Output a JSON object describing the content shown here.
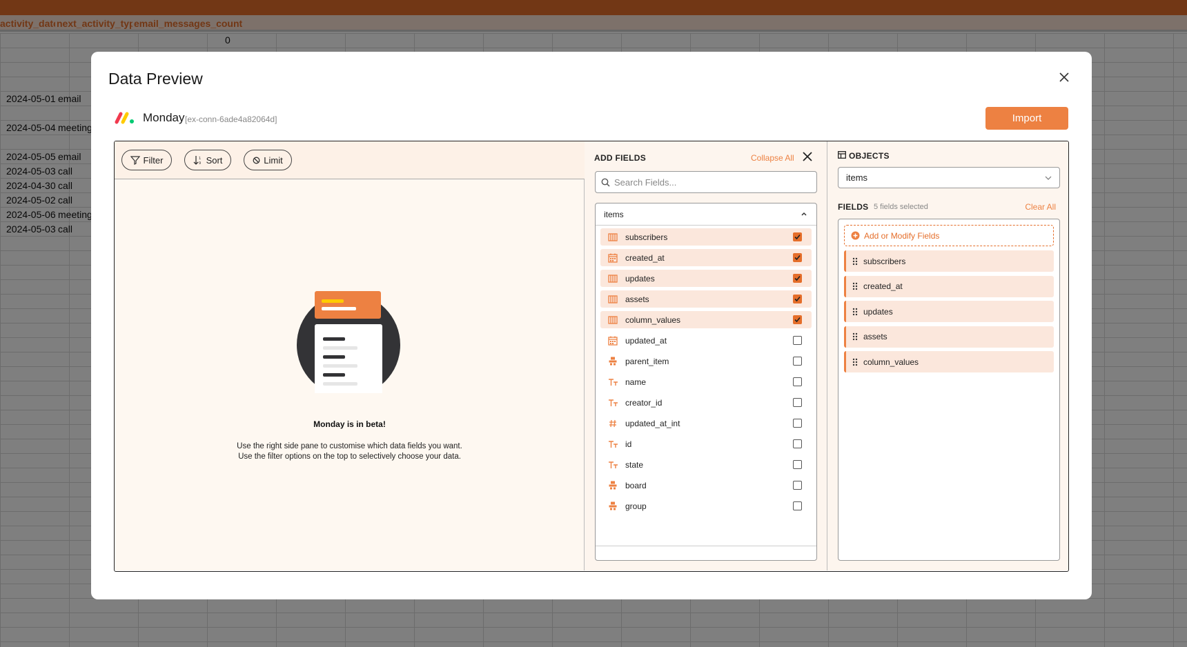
{
  "spreadsheet": {
    "headers": [
      "activity_date",
      "next_activity_type",
      "email_messages_count"
    ],
    "rows": [
      {
        "col_c": "0"
      },
      {
        "date": "2024-05-01",
        "type": "email"
      },
      {
        "date": "2024-05-04",
        "type": "meeting"
      },
      {
        "date": "2024-05-05",
        "type": "email"
      },
      {
        "date": "2024-05-03",
        "type": "call"
      },
      {
        "date": "2024-04-30",
        "type": "call"
      },
      {
        "date": "2024-05-02",
        "type": "call"
      },
      {
        "date": "2024-05-06",
        "type": "meeting"
      },
      {
        "date": "2024-05-03",
        "type": "call"
      }
    ]
  },
  "modal": {
    "title": "Data Preview",
    "close_icon": "close-icon",
    "connector": {
      "name": "Monday",
      "id": "[ex-conn-6ade4a82064d]"
    },
    "import_label": "Import"
  },
  "toolbar": {
    "filter": "Filter",
    "sort": "Sort",
    "limit": "Limit"
  },
  "empty_state": {
    "title": "Monday is in beta!",
    "line1": "Use the right side pane to customise which data fields you want.",
    "line2": "Use the filter options on the top to selectively choose your data."
  },
  "add_fields": {
    "title": "ADD FIELDS",
    "collapse_all": "Collapse All",
    "search_placeholder": "Search Fields...",
    "group": "items",
    "fields": [
      {
        "name": "subscribers",
        "icon": "list-icon",
        "checked": true
      },
      {
        "name": "created_at",
        "icon": "calendar-icon",
        "checked": true
      },
      {
        "name": "updates",
        "icon": "list-icon",
        "checked": true
      },
      {
        "name": "assets",
        "icon": "list-icon",
        "checked": true
      },
      {
        "name": "column_values",
        "icon": "list-icon",
        "checked": true
      },
      {
        "name": "updated_at",
        "icon": "calendar-icon",
        "checked": false
      },
      {
        "name": "parent_item",
        "icon": "object-icon",
        "checked": false
      },
      {
        "name": "name",
        "icon": "text-icon",
        "checked": false
      },
      {
        "name": "creator_id",
        "icon": "text-icon",
        "checked": false
      },
      {
        "name": "updated_at_int",
        "icon": "hash-icon",
        "checked": false
      },
      {
        "name": "id",
        "icon": "text-icon",
        "checked": false
      },
      {
        "name": "state",
        "icon": "text-icon",
        "checked": false
      },
      {
        "name": "board",
        "icon": "object-icon",
        "checked": false
      },
      {
        "name": "group",
        "icon": "object-icon",
        "checked": false
      }
    ]
  },
  "objects": {
    "title": "OBJECTS",
    "selected": "items",
    "fields_label": "FIELDS",
    "fields_count": "5 fields selected",
    "clear_all": "Clear All",
    "add_modify": "Add or Modify Fields",
    "selected_fields": [
      "subscribers",
      "created_at",
      "updates",
      "assets",
      "column_values"
    ]
  },
  "colors": {
    "accent": "#ed8142",
    "accent_light": "#fbe7dc",
    "panel_bg": "#fdf5ee"
  }
}
